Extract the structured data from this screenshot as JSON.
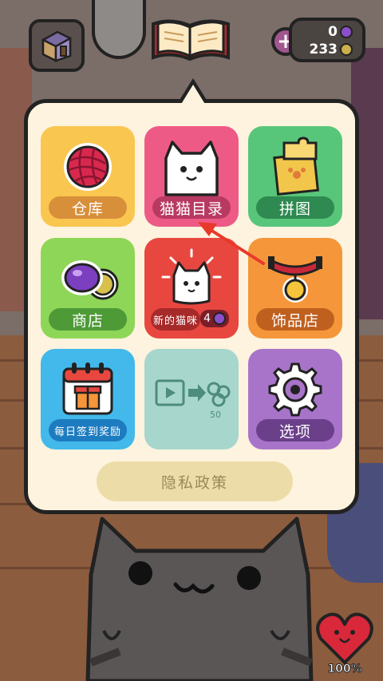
{
  "header": {
    "house_icon": "house-icon",
    "book_icon": "cat-book-icon",
    "gems": "0",
    "coins": "233",
    "plus_label": "+"
  },
  "menu": {
    "tiles": [
      {
        "label": "仓库",
        "icon": "yarn-ball-icon",
        "color": "#f9c64f"
      },
      {
        "label": "猫猫目录",
        "icon": "cat-catalog-icon",
        "color": "#ee5a86"
      },
      {
        "label": "拼图",
        "icon": "puzzle-icon",
        "color": "#58c67a"
      },
      {
        "label": "商店",
        "icon": "gem-coin-icon",
        "color": "#8ed657"
      },
      {
        "label": "新的猫咪",
        "badge": "4",
        "icon": "new-cat-icon",
        "color": "#e8473f"
      },
      {
        "label": "饰品店",
        "icon": "collar-icon",
        "color": "#f5963a"
      },
      {
        "label": "每日签到奖励",
        "icon": "calendar-gift-icon",
        "color": "#42b9ea"
      },
      {
        "label": "",
        "icon": "ad-video-reward-icon",
        "ad_reward": "50",
        "color": "#a7d6cd"
      },
      {
        "label": "选项",
        "icon": "gear-icon",
        "color": "#a874c9"
      }
    ],
    "privacy_label": "隐私政策"
  },
  "footer": {
    "health_percent": "100%"
  },
  "colors": {
    "panel_bg": "#fef3de",
    "outline": "#222222",
    "annotation_arrow": "#e8392c"
  }
}
